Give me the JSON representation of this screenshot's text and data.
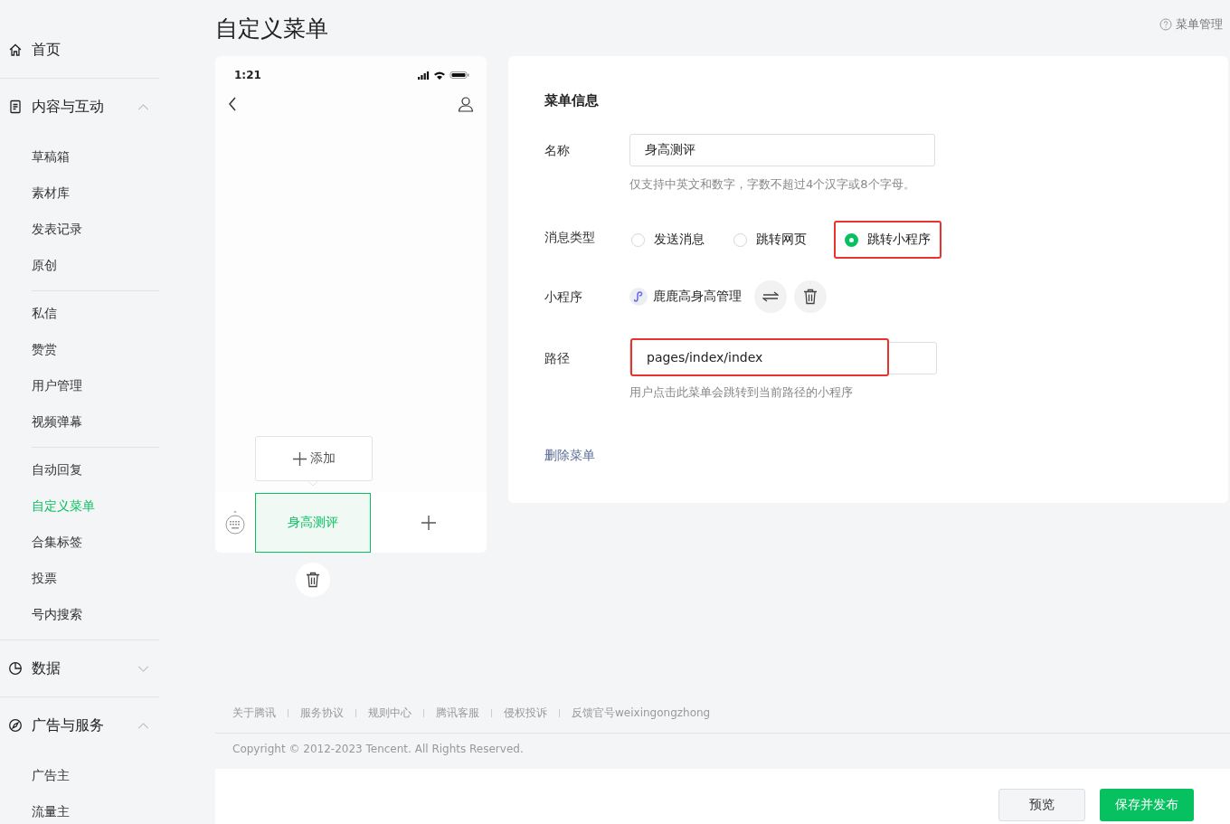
{
  "sidebar": [
    {
      "kind": "link",
      "label": "首页"
    },
    {
      "kind": "group",
      "label": "内容与互动",
      "expanded": true,
      "subgroups": [
        [
          {
            "label": "草稿箱",
            "selected": false
          },
          {
            "label": "素材库",
            "selected": false
          },
          {
            "label": "发表记录",
            "selected": false
          },
          {
            "label": "原创",
            "selected": false
          }
        ],
        [
          {
            "label": "私信",
            "selected": false
          },
          {
            "label": "赞赏",
            "selected": false
          },
          {
            "label": "用户管理",
            "selected": false
          },
          {
            "label": "视频弹幕",
            "selected": false
          }
        ],
        [
          {
            "label": "自动回复",
            "selected": false
          },
          {
            "label": "自定义菜单",
            "selected": true
          },
          {
            "label": "合集标签",
            "selected": false
          },
          {
            "label": "投票",
            "selected": false
          },
          {
            "label": "号内搜索",
            "selected": false
          }
        ]
      ]
    },
    {
      "kind": "group",
      "label": "数据",
      "expanded": false
    },
    {
      "kind": "group",
      "label": "广告与服务",
      "expanded": true,
      "subgroups": [
        [
          {
            "label": "广告主",
            "selected": false
          },
          {
            "label": "流量主",
            "selected": false
          }
        ]
      ]
    }
  ],
  "page_title": "自定义菜单",
  "help_link": "菜单管理",
  "phone": {
    "time": "1:21",
    "popup_label": "添加",
    "menu_buttons": [
      {
        "label": "身高测评",
        "selected": true
      }
    ]
  },
  "form": {
    "title": "菜单信息",
    "name": {
      "label": "名称",
      "value": "身高测评",
      "hint": "仅支持中英文和数字，字数不超过4个汉字或8个字母。"
    },
    "message_type": {
      "label": "消息类型",
      "options": [
        {
          "label": "发送消息",
          "selected": false,
          "highlighted": false
        },
        {
          "label": "跳转网页",
          "selected": false,
          "highlighted": false
        },
        {
          "label": "跳转小程序",
          "selected": true,
          "highlighted": true
        }
      ]
    },
    "mini_program": {
      "label": "小程序",
      "name": "鹿鹿高身高管理"
    },
    "path": {
      "label": "路径",
      "value": "pages/index/index",
      "highlighted": true,
      "hint": "用户点击此菜单会跳转到当前路径的小程序"
    },
    "delete_link": "删除菜单"
  },
  "footer": {
    "links": [
      "关于腾讯",
      "服务协议",
      "规则中心",
      "腾讯客服",
      "侵权投诉",
      "反馈官号weixingongzhong"
    ],
    "copyright": "Copyright © 2012-2023 Tencent. All Rights Reserved."
  },
  "actions": {
    "preview": "预览",
    "publish": "保存并发布"
  }
}
